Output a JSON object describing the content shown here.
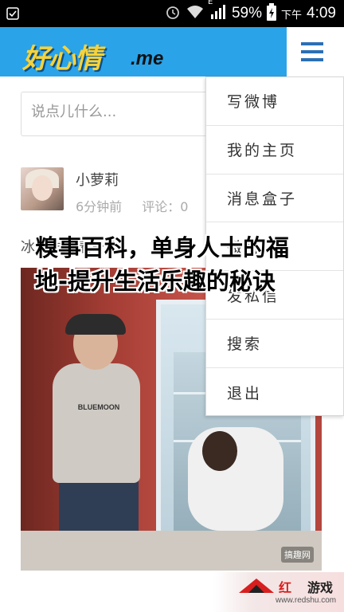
{
  "status_bar": {
    "battery_percent": "59%",
    "time_period": "下午",
    "time": "4:09",
    "network_type": "E",
    "icons": [
      "alarm-icon",
      "wifi-icon",
      "signal-icon",
      "battery-charging-icon"
    ]
  },
  "header": {
    "logo_main": "好心情",
    "logo_suffix": ".me",
    "menu_icon": "hamburger-menu-icon",
    "brand_color": "#2aa3e9",
    "logo_color": "#f6d23b"
  },
  "composer": {
    "placeholder": "说点儿什么..."
  },
  "feed": {
    "post": {
      "username": "小萝莉",
      "time_ago": "6分钟前",
      "comments": "评论：0",
      "text": "冰箱里藏着一个",
      "photo_watermark": "搞趣网",
      "shirt_text": "BLUEMOON"
    }
  },
  "menu": {
    "items": [
      {
        "label": "写微博"
      },
      {
        "label": "我的主页"
      },
      {
        "label": "消息盒子"
      },
      {
        "label": "微博"
      },
      {
        "label": "发私信"
      },
      {
        "label": "搜索"
      },
      {
        "label": "退出"
      }
    ]
  },
  "overlay": {
    "headline": "糗事百科，单身人士的福地-提升生活乐趣的秘诀"
  },
  "banner": {
    "text_red": "红",
    "text_black": "游戏",
    "url": "www.redshu.com"
  }
}
